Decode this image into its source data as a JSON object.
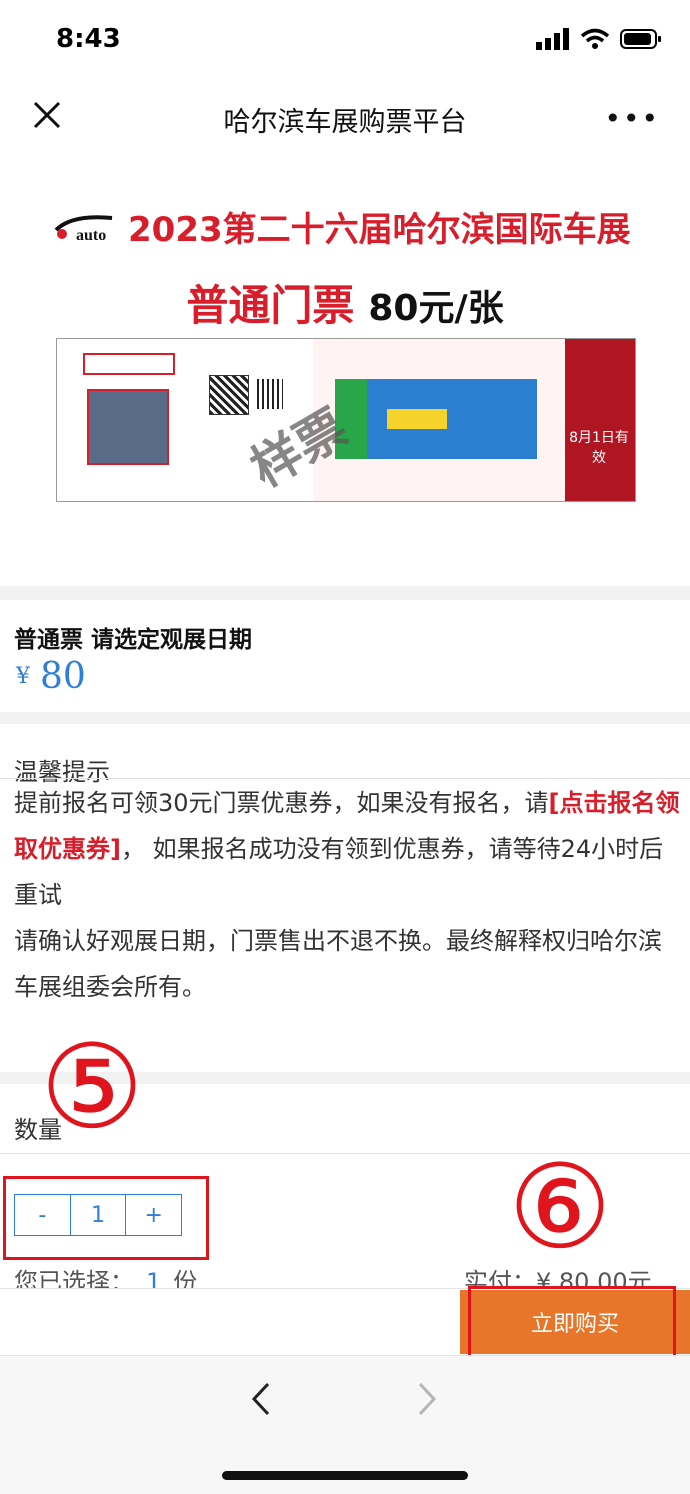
{
  "status_bar": {
    "time": "8:43"
  },
  "nav": {
    "title": "哈尔滨车展购票平台",
    "close_icon": "close-icon",
    "more_icon": "more-icon"
  },
  "banner": {
    "logo_text": "auto",
    "headline": "2023第二十六届哈尔滨国际车展",
    "ticket_type": "普通门票",
    "price_text": "80元/张",
    "watermark": "样票",
    "valid_text": "8月1日有效"
  },
  "ticket": {
    "name": "普通票 请选定观展日期",
    "currency": "¥",
    "price": "80"
  },
  "tips": {
    "title": "温馨提示",
    "line1_a": "提前报名可领30元门票优惠券，如果没有报名，请",
    "line1_link": "[点击报名领取优惠券]",
    "line1_b": "， 如果报名成功没有领到优惠券，请等待24小时后重试",
    "line2": "请确认好观展日期，门票售出不退不换。最终解释权归哈尔滨车展组委会所有。"
  },
  "quantity": {
    "label": "数量",
    "minus": "-",
    "value": "1",
    "plus": "+",
    "selected_prefix": "您已选择：",
    "selected_count": "1",
    "selected_unit": "份",
    "paid_text": "实付：¥ 80.00元"
  },
  "buy_button": "立即购买",
  "annotations": {
    "step5": "⑤",
    "step6": "⑥"
  },
  "toolbar": {
    "back_icon": "back-arrow-icon",
    "forward_icon": "forward-arrow-icon"
  },
  "colors": {
    "accent_blue": "#2f7fd8",
    "brand_red": "#d81e2a",
    "buy_orange": "#e8762a"
  }
}
